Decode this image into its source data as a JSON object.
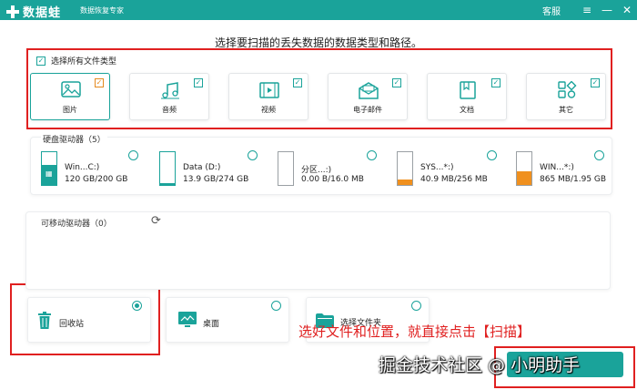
{
  "titlebar": {
    "app_name": "数据蛙",
    "slogan": "数据恢复专家",
    "service": "客服",
    "menu_icon": "menu-icon",
    "minimize_icon": "minimize-icon",
    "close_icon": "close-icon"
  },
  "prompt": "选择要扫描的丢失数据的数据类型和路径。",
  "file_types": {
    "select_all_label": "选择所有文件类型",
    "select_all_checked": true,
    "items": [
      {
        "label": "图片",
        "icon": "image-icon",
        "checked": true,
        "selected": true
      },
      {
        "label": "音频",
        "icon": "audio-icon",
        "checked": true,
        "selected": false
      },
      {
        "label": "视频",
        "icon": "video-icon",
        "checked": true,
        "selected": false
      },
      {
        "label": "电子邮件",
        "icon": "email-icon",
        "checked": true,
        "selected": false
      },
      {
        "label": "文档",
        "icon": "document-icon",
        "checked": true,
        "selected": false
      },
      {
        "label": "其它",
        "icon": "other-icon",
        "checked": true,
        "selected": false
      }
    ]
  },
  "hard_drives": {
    "title": "硬盘驱动器（5）",
    "items": [
      {
        "name": "Win...C:)",
        "size": "120 GB/200 GB",
        "used_fraction": 0.6
      },
      {
        "name": "Data (D:)",
        "size": "13.9 GB/274 GB",
        "used_fraction": 0.05
      },
      {
        "name": "分区...:)",
        "size": "0.00  B/16.0 MB",
        "used_fraction": 0.0
      },
      {
        "name": "SYS...*:)",
        "size": "40.9 MB/256 MB",
        "used_fraction": 0.16
      },
      {
        "name": "WIN...*:)",
        "size": "865 MB/1.95 GB",
        "used_fraction": 0.43
      }
    ]
  },
  "removable_drives": {
    "title": "可移动驱动器（0）",
    "refresh_icon": "refresh-icon"
  },
  "locations": [
    {
      "label": "回收站",
      "icon": "recycle-bin-icon",
      "selected": true
    },
    {
      "label": "桌面",
      "icon": "desktop-icon",
      "selected": false
    },
    {
      "label": "选择文件夹",
      "icon": "folder-icon",
      "selected": false
    }
  ],
  "annotation": "选好文件和位置，就直接点击【扫描】",
  "watermark": "掘金技术社区 @ 小明助手",
  "colors": {
    "accent": "#1aa39a",
    "highlight": "#e02020",
    "check_orange": "#e58a1f",
    "drive_fill_orange": "#f0901e"
  }
}
